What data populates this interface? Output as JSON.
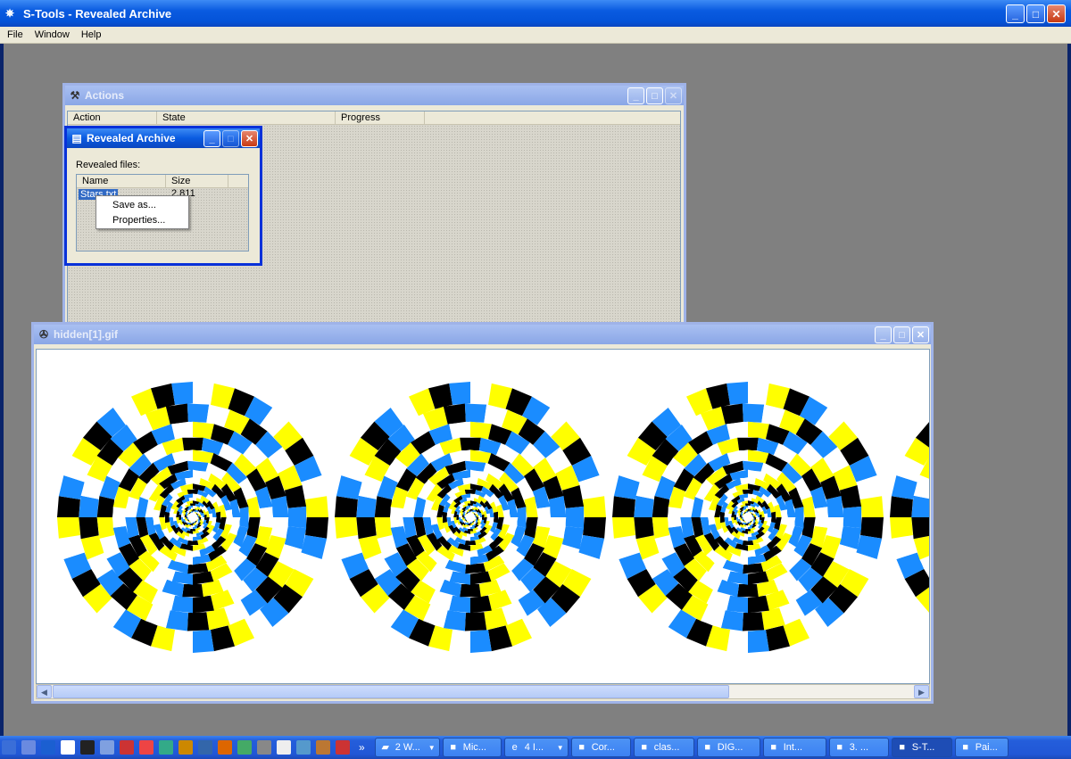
{
  "app": {
    "title": "S-Tools - Revealed Archive",
    "caption_min": "_",
    "caption_max": "□",
    "caption_close": "✕"
  },
  "menu": [
    "File",
    "Window",
    "Help"
  ],
  "actions_window": {
    "title": "Actions",
    "columns": [
      "Action",
      "State",
      "Progress"
    ]
  },
  "revealed_window": {
    "title": "Revealed Archive",
    "label": "Revealed files:",
    "columns": [
      "Name",
      "Size"
    ],
    "rows": [
      {
        "name": "Stars.txt",
        "size": "2,811"
      }
    ]
  },
  "context_menu": [
    "Save as...",
    "Properties..."
  ],
  "image_window": {
    "title": "hidden[1].gif"
  },
  "illusion": {
    "colors": {
      "black": "#000000",
      "blue": "#1a8cff",
      "yellow": "#ffff00",
      "white": "#ffffff"
    }
  },
  "taskbar": {
    "quick_launch": [
      "desktop-icon",
      "app-icon",
      "app-icon",
      "app-icon",
      "app-icon",
      "app-icon",
      "app-icon",
      "app-icon",
      "app-icon",
      "app-icon",
      "app-icon",
      "app-icon",
      "app-icon",
      "app-icon",
      "app-icon",
      "app-icon",
      "app-icon",
      "app-icon"
    ],
    "more": "»",
    "buttons": [
      {
        "label": "2 W...",
        "icon": "folder-icon",
        "dropdown": true
      },
      {
        "label": "Mic...",
        "icon": "app-icon",
        "dropdown": false
      },
      {
        "label": "4 I...",
        "icon": "ie-icon",
        "dropdown": true
      },
      {
        "label": "Cor...",
        "icon": "app-icon",
        "dropdown": false
      },
      {
        "label": "clas...",
        "icon": "app-icon",
        "dropdown": false
      },
      {
        "label": "DIG...",
        "icon": "app-icon",
        "dropdown": false
      },
      {
        "label": "Int...",
        "icon": "app-icon",
        "dropdown": false
      },
      {
        "label": "3. ...",
        "icon": "app-icon",
        "dropdown": false
      },
      {
        "label": "S-T...",
        "icon": "stools-icon",
        "dropdown": false,
        "active": true
      },
      {
        "label": "Pai...",
        "icon": "paint-icon",
        "dropdown": false
      }
    ]
  }
}
